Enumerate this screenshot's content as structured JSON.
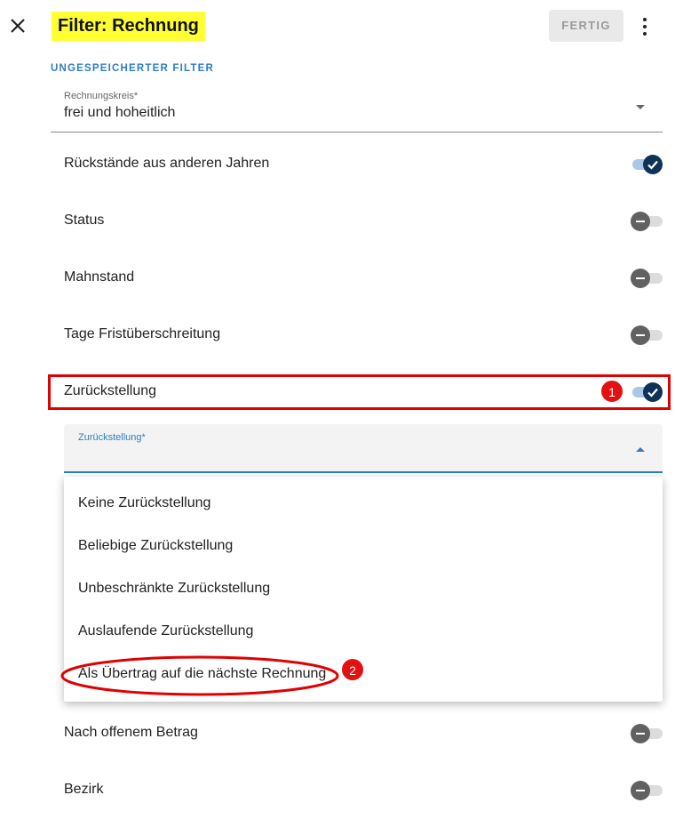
{
  "header": {
    "title": "Filter: Rechnung",
    "done_label": "FERTIG"
  },
  "section_label": "UNGESPEICHERTER FILTER",
  "rechnungskreis": {
    "label": "Rechnungskreis*",
    "value": "frei und hoheitlich"
  },
  "filters": [
    {
      "label": "Rückstände aus anderen Jahren",
      "enabled": true
    },
    {
      "label": "Status",
      "enabled": false
    },
    {
      "label": "Mahnstand",
      "enabled": false
    },
    {
      "label": "Tage Fristüberschreitung",
      "enabled": false
    },
    {
      "label": "Zurückstellung",
      "enabled": true
    },
    {
      "label": "Nach offenem Betrag",
      "enabled": false
    },
    {
      "label": "Bezirk",
      "enabled": false
    }
  ],
  "zurueckstellung_select": {
    "label": "Zurückstellung*",
    "options": [
      "Keine Zurückstellung",
      "Beliebige Zurückstellung",
      "Unbeschränkte Zurückstellung",
      "Auslaufende Zurückstellung",
      "Als Übertrag auf die nächste Rechnung"
    ]
  },
  "annotations": {
    "badge_1": "1",
    "badge_2": "2",
    "color": "#e21212"
  },
  "colors": {
    "accent": "#2f7dc0",
    "toggle_on": "#0f3257",
    "title_highlight": "#ffff33"
  },
  "icons": {
    "close": "close-icon",
    "more": "more-vert-icon",
    "check": "check-icon",
    "minus": "minus-icon"
  }
}
